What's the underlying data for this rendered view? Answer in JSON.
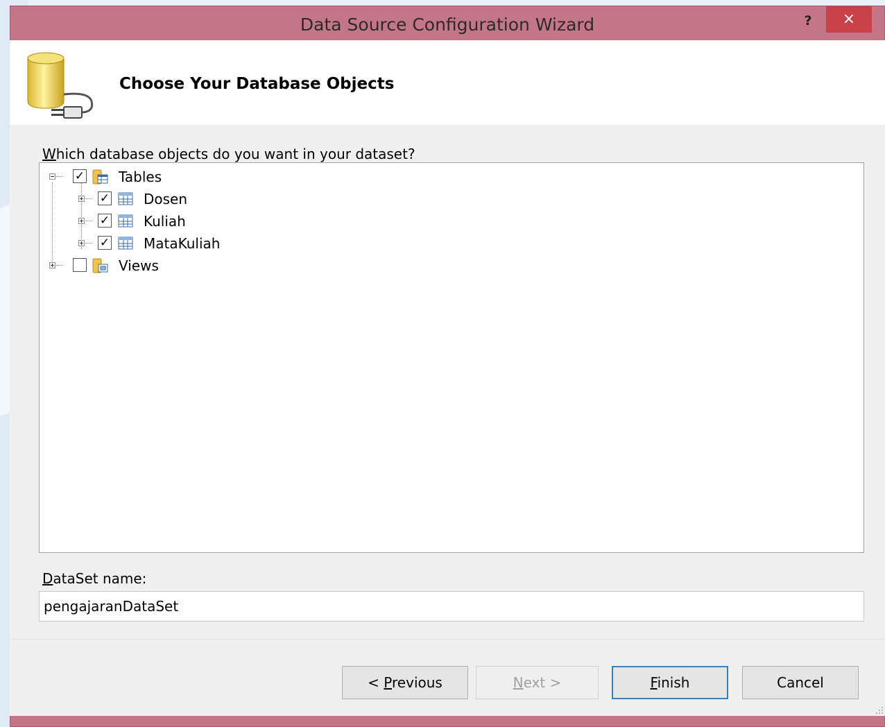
{
  "window": {
    "title": "Data Source Configuration Wizard",
    "help_label": "?",
    "close_label": "×",
    "frame_color": "#c47686",
    "close_color": "#c9424a"
  },
  "header": {
    "title": "Choose Your Database Objects",
    "icon": "database-plug-icon"
  },
  "tree": {
    "prompt_mnemonic": "W",
    "prompt_rest": "hich database objects do you want in your dataset?",
    "nodes": [
      {
        "label": "Tables",
        "checked": true,
        "expanded": true,
        "icon": "tables-folder-icon",
        "children": [
          {
            "label": "Dosen",
            "checked": true,
            "icon": "table-icon"
          },
          {
            "label": "Kuliah",
            "checked": true,
            "icon": "table-icon"
          },
          {
            "label": "MataKuliah",
            "checked": true,
            "icon": "table-icon"
          }
        ]
      },
      {
        "label": "Views",
        "checked": false,
        "expanded": false,
        "icon": "views-folder-icon"
      }
    ]
  },
  "dataset": {
    "label_mnemonic": "D",
    "label_rest": "ataSet name:",
    "value": "pengajaranDataSet"
  },
  "buttons": {
    "previous_prefix": "< ",
    "previous_mnemonic": "P",
    "previous_rest": "revious",
    "next_mnemonic": "N",
    "next_rest": "ext >",
    "finish_mnemonic": "F",
    "finish_rest": "inish",
    "cancel": "Cancel"
  }
}
